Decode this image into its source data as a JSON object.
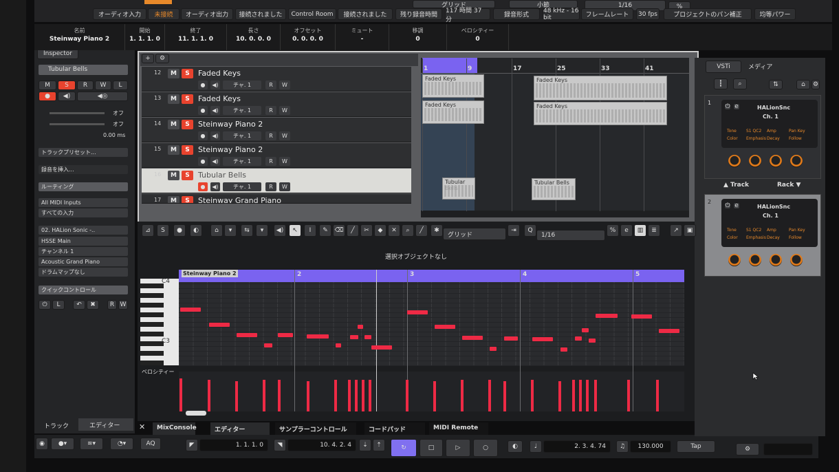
{
  "top_bar": {
    "row1": [
      {
        "label": "オーディオ入力"
      },
      {
        "label": "未接続"
      },
      {
        "label": "オーディオ出力"
      },
      {
        "label": "接続されました"
      },
      {
        "label": "Control Room"
      },
      {
        "label": "接続されました"
      },
      {
        "label": "残り録音時間"
      },
      {
        "label": "117 時間 37 分"
      },
      {
        "label": "録音形式"
      },
      {
        "label": "48 kHz - 16 bit"
      },
      {
        "label": "フレームレート"
      },
      {
        "label": "30 fps"
      },
      {
        "label": "プロジェクトのパン補正"
      },
      {
        "label": "均等パワー"
      }
    ],
    "grid_label": "グリッド",
    "bar_label": "小節",
    "quantize": "1/16"
  },
  "info_line": {
    "fields": [
      {
        "title": "名前",
        "value": "Steinway Piano 2"
      },
      {
        "title": "開始",
        "value": "1. 1. 1.   0"
      },
      {
        "title": "終了",
        "value": "11. 1. 1.   0"
      },
      {
        "title": "長さ",
        "value": "10. 0. 0.   0"
      },
      {
        "title": "オフセット",
        "value": "0. 0. 0.   0"
      },
      {
        "title": "ミュート",
        "value": "-"
      },
      {
        "title": "移調",
        "value": "0"
      },
      {
        "title": "ベロシティー",
        "value": "0"
      }
    ]
  },
  "inspector": {
    "tab": "Inspector",
    "track_name": "Tubular Bells",
    "buttons": [
      "M",
      "S",
      "R",
      "W",
      "L"
    ],
    "fader1_value": "オフ",
    "fader2_value": "オフ",
    "delay_value": "0.00 ms",
    "track_preset": "トラックプリセット...",
    "insert_label": "録音を挿入...",
    "routing_label": "ルーティング",
    "midi_in": "All MIDI Inputs",
    "input_all": "すべての入力",
    "instrument": "02. HALion Sonic -..",
    "output": "HSSE Main",
    "channel": "チャンネル 1",
    "program": "Acoustic Grand Piano",
    "drum_map": "ドラムマップなし",
    "quick_control": "クイックコントロール",
    "footer_tabs": [
      "トラック",
      "エディター"
    ]
  },
  "tracks": [
    {
      "num": "12",
      "name": "Faded Keys",
      "channel": "チャ. 1",
      "selected": false
    },
    {
      "num": "13",
      "name": "Faded Keys",
      "channel": "チャ. 1",
      "selected": false
    },
    {
      "num": "14",
      "name": "Steinway Piano 2",
      "channel": "チャ. 1",
      "selected": false
    },
    {
      "num": "15",
      "name": "Steinway Piano 2",
      "channel": "チャ. 1",
      "selected": false
    },
    {
      "num": "16",
      "name": "Tubular Bells",
      "channel": "チャ. 1",
      "selected": true
    },
    {
      "num": "17",
      "name": "Steinway Grand Piano",
      "channel": "",
      "selected": false
    }
  ],
  "ruler": [
    "1",
    "9",
    "17",
    "25",
    "33",
    "41"
  ],
  "clips": [
    {
      "name": "Faded Keys"
    },
    {
      "name": "Faded Keys"
    },
    {
      "name": "Faded Keys"
    },
    {
      "name": "Faded Keys"
    },
    {
      "name": "Tubular Bells"
    },
    {
      "name": "Tubular Bells"
    }
  ],
  "editor": {
    "grid": "グリッド",
    "quantize": "1/16",
    "status": "選択オブジェクトなし",
    "part_name": "Steinway Piano 2",
    "bars": [
      "2",
      "3",
      "4",
      "5"
    ],
    "keys": [
      "C4",
      "C3"
    ],
    "velocity_label": "ベロシティー"
  },
  "bottom_tabs": [
    "MixConsole",
    "エディター",
    "サンプラーコントロール",
    "コードパッド",
    "MIDI Remote"
  ],
  "transport": {
    "left_locator": "1. 1. 1.   0",
    "right_locator": "10. 4. 2.   4",
    "position": "2. 3. 4. 74",
    "tempo": "130.000",
    "tap": "Tap",
    "aq": "AQ"
  },
  "vsti": {
    "tabs": [
      "VSTi",
      "メディア"
    ],
    "slots": [
      {
        "num": "1",
        "name": "HALionSnc",
        "channel": "Ch. 1",
        "labels": [
          "Tone",
          "S1 QC2",
          "Amp",
          "Pan Key",
          "Color",
          "Emphasis",
          "Decay",
          "Follow"
        ]
      },
      {
        "num": "2",
        "name": "HALionSnc",
        "channel": "Ch. 1",
        "labels": [
          "Tone",
          "S1 QC2",
          "Amp",
          "Pan Key",
          "Color",
          "Emphasis",
          "Decay",
          "Follow"
        ]
      }
    ],
    "track_label": "Track",
    "rack_label": "Rack"
  },
  "colors": {
    "accent_purple": "#7a63f0",
    "note_red": "#ee2a45",
    "orange": "#e8892a"
  }
}
